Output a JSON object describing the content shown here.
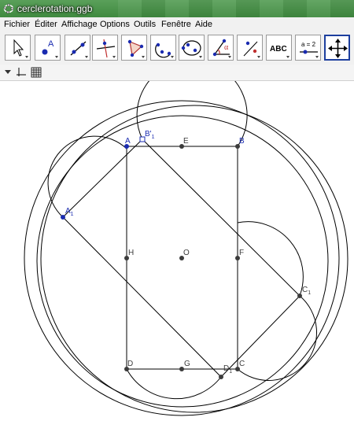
{
  "window": {
    "title": "cerclerotation.ggb"
  },
  "menu": [
    "Fichier",
    "Éditer",
    "Affichage",
    "Options",
    "Outils",
    "Fenêtre",
    "Aide"
  ],
  "toolbar": {
    "tools": [
      {
        "name": "move-tool-icon"
      },
      {
        "name": "new-point-tool-icon",
        "text": "A"
      },
      {
        "name": "line-tool-icon"
      },
      {
        "name": "perpendicular-line-tool-icon"
      },
      {
        "name": "polygon-tool-icon"
      },
      {
        "name": "circle-through-points-tool-icon"
      },
      {
        "name": "conic-tool-icon"
      },
      {
        "name": "angle-tool-icon",
        "text": "α"
      },
      {
        "name": "reflect-about-line-tool-icon"
      },
      {
        "name": "text-tool-icon",
        "text": "ABC"
      },
      {
        "name": "slider-tool-icon",
        "text": "a = 2"
      },
      {
        "name": "move-graphics-view-tool-icon"
      }
    ]
  },
  "graphics": {
    "colors": {
      "point": "#3b3b3b",
      "free_point": "#1a2bb0",
      "label_blue": "#1a2bb0",
      "stroke": "#000000"
    },
    "points": {
      "A": {
        "label": "A"
      },
      "B": {
        "label": "B"
      },
      "C": {
        "label": "C"
      },
      "D": {
        "label": "D"
      },
      "E": {
        "label": "E"
      },
      "F": {
        "label": "F"
      },
      "G": {
        "label": "G"
      },
      "H": {
        "label": "H"
      },
      "O": {
        "label": "O"
      },
      "A1": {
        "label": "A",
        "sub": "1"
      },
      "B1": {
        "label": "B'",
        "sub": "1"
      },
      "C1": {
        "label": "C",
        "sub": "1"
      },
      "D1": {
        "label": "D",
        "sub": "1"
      }
    }
  }
}
